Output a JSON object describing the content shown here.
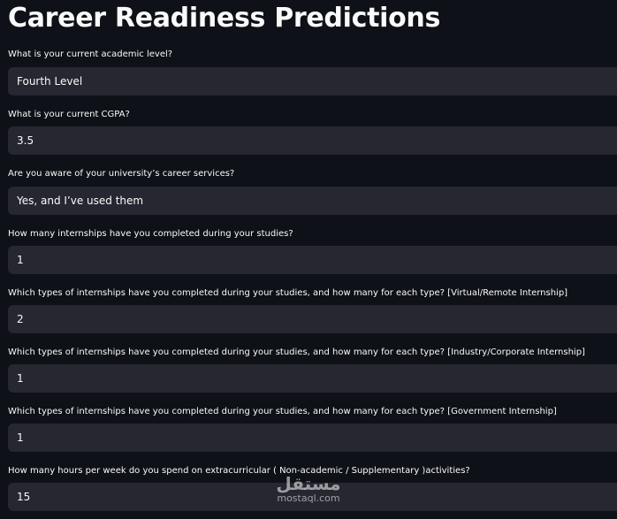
{
  "page": {
    "title": "Career Readiness Predictions"
  },
  "questions": [
    {
      "label": "What is your current academic level?",
      "value": "Fourth Level"
    },
    {
      "label": "What is your current CGPA?",
      "value": "3.5"
    },
    {
      "label": "Are you aware of your university’s career services?",
      "value": "Yes, and I’ve used them"
    },
    {
      "label": "How many internships have you completed during your studies?",
      "value": "1"
    },
    {
      "label": "Which types of internships have you completed during your studies, and how many for each type? [Virtual/Remote Internship]",
      "value": "2"
    },
    {
      "label": "Which types of internships have you completed during your studies, and how many for each type? [Industry/Corporate Internship]",
      "value": "1"
    },
    {
      "label": "Which types of internships have you completed during your studies, and how many for each type? [Government Internship]",
      "value": "1"
    },
    {
      "label": "How many hours per week do you spend on extracurricular ( Non-academic / Supplementary )activities?",
      "value": "15"
    }
  ],
  "watermark": {
    "logo_text": "مستقل",
    "domain": "mostaql.com"
  },
  "colors": {
    "background": "#0e1117",
    "field_background": "#262730",
    "text": "#fafafa"
  }
}
